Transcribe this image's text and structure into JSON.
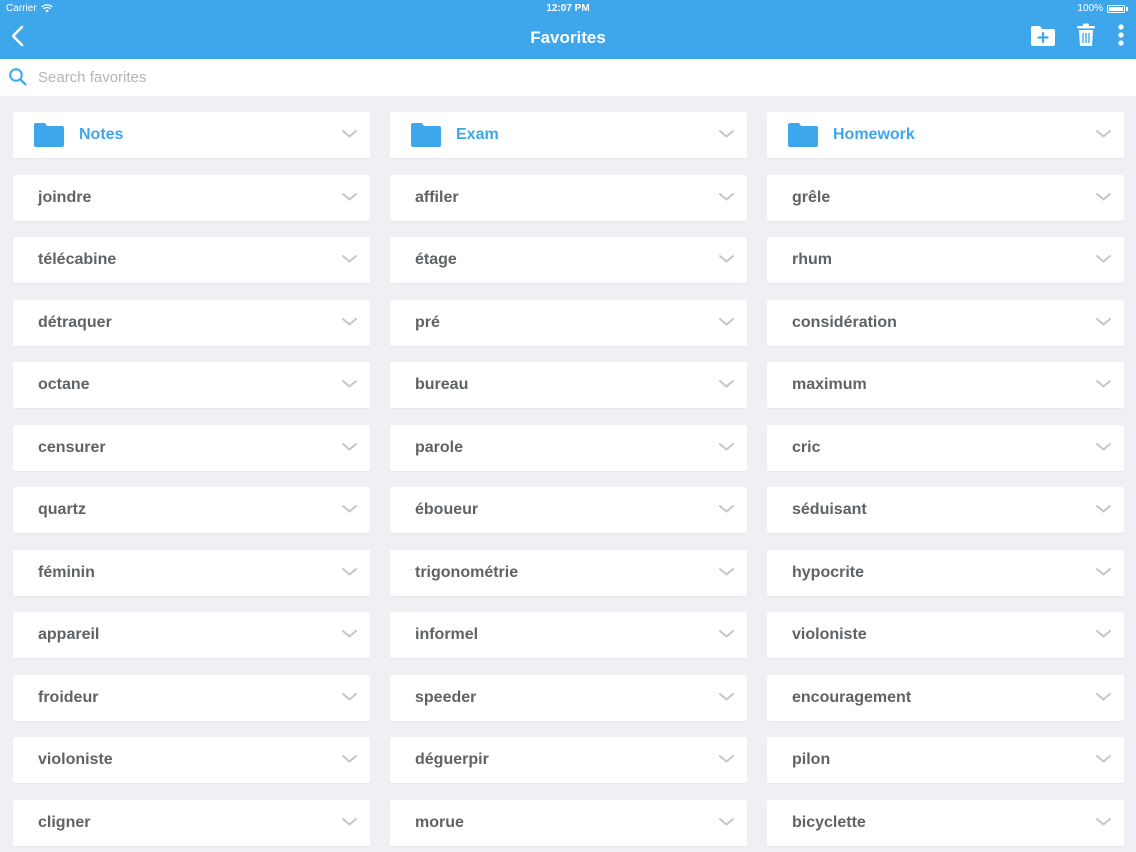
{
  "status": {
    "carrier": "Carrier",
    "time": "12:07 PM",
    "battery": "100%"
  },
  "nav": {
    "title": "Favorites",
    "icons": {
      "back": "chevron-left-icon",
      "add_folder": "folder-add-icon",
      "delete": "trash-icon",
      "more": "more-vertical-icon"
    }
  },
  "search": {
    "placeholder": "Search favorites",
    "value": ""
  },
  "colors": {
    "accent": "#3ea7ec",
    "background": "#efeff4",
    "text": "#5f6366",
    "chevron": "#c4c6c8"
  },
  "columns": [
    {
      "folder": "Notes",
      "items": [
        "joindre",
        "télécabine",
        "détraquer",
        "octane",
        "censurer",
        "quartz",
        "féminin",
        "appareil",
        "froideur",
        "violoniste",
        "cligner"
      ]
    },
    {
      "folder": "Exam",
      "items": [
        "affiler",
        "étage",
        "pré",
        "bureau",
        "parole",
        "éboueur",
        "trigonométrie",
        "informel",
        "speeder",
        "déguerpir",
        "morue"
      ]
    },
    {
      "folder": "Homework",
      "items": [
        "grêle",
        "rhum",
        "considération",
        "maximum",
        "cric",
        "séduisant",
        "hypocrite",
        "violoniste",
        "encouragement",
        "pilon",
        "bicyclette"
      ]
    }
  ]
}
